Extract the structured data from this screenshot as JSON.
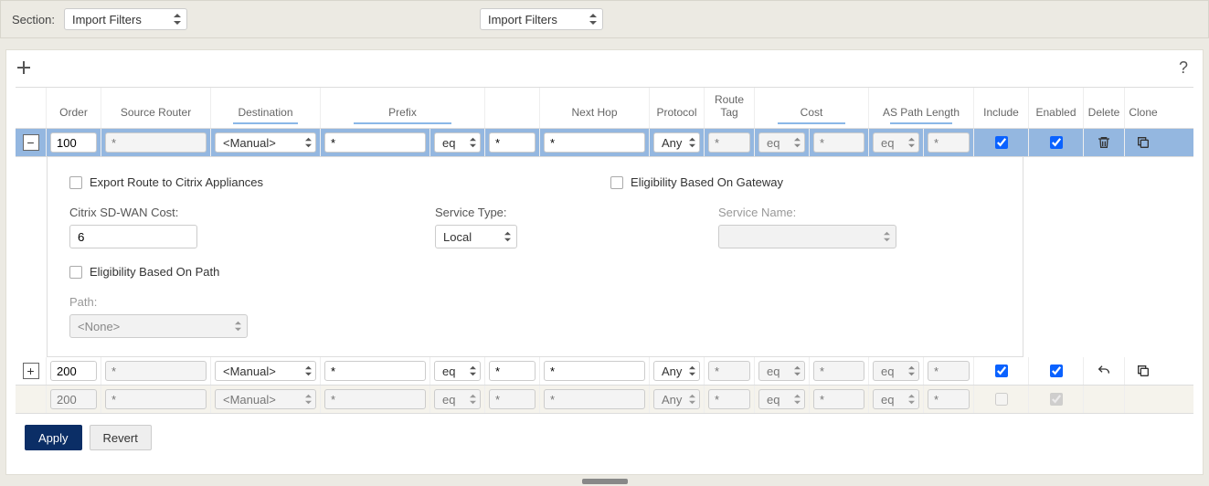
{
  "section": {
    "label": "Section:",
    "value_1": "Import Filters",
    "value_2": "Import Filters"
  },
  "toolbar": {
    "add_icon": "add-icon",
    "help_icon": "help-icon"
  },
  "columns": {
    "expand": "",
    "order": "Order",
    "source_router": "Source Router",
    "destination": "Destination",
    "prefix": "Prefix",
    "next_hop": "Next Hop",
    "protocol": "Protocol",
    "route_tag": "Route\nTag",
    "cost": "Cost",
    "as_path_length": "AS Path Length",
    "include": "Include",
    "enabled": "Enabled",
    "delete": "Delete",
    "clone": "Clone"
  },
  "rows": [
    {
      "expanded": true,
      "order": "100",
      "source_router": "*",
      "destination": "<Manual>",
      "prefix": "*",
      "prefix_op": "eq",
      "prefix_val": "*",
      "next_hop": "*",
      "protocol": "Any",
      "route_tag": "*",
      "cost_op": "eq",
      "cost_val": "*",
      "as_op": "eq",
      "as_val": "*",
      "include": true,
      "enabled": true,
      "delete_icon": "trash-icon",
      "clone_icon": "clone-icon"
    },
    {
      "expanded": false,
      "order": "200",
      "source_router": "*",
      "destination": "<Manual>",
      "prefix": "*",
      "prefix_op": "eq",
      "prefix_val": "*",
      "next_hop": "*",
      "protocol": "Any",
      "route_tag": "*",
      "cost_op": "eq",
      "cost_val": "*",
      "as_op": "eq",
      "as_val": "*",
      "include": true,
      "enabled": true,
      "delete_icon": "undo-icon",
      "clone_icon": "clone-icon"
    },
    {
      "readonly": true,
      "order": "200",
      "source_router": "*",
      "destination": "<Manual>",
      "prefix": "*",
      "prefix_op": "eq",
      "prefix_val": "*",
      "next_hop": "*",
      "protocol": "Any",
      "route_tag": "*",
      "cost_op": "eq",
      "cost_val": "*",
      "as_op": "eq",
      "as_val": "*",
      "include": false,
      "enabled": true
    }
  ],
  "detail": {
    "export_label": "Export Route to Citrix Appliances",
    "gateway_label": "Eligibility Based On Gateway",
    "sdwan_cost_label": "Citrix SD-WAN Cost:",
    "sdwan_cost_value": "6",
    "service_type_label": "Service Type:",
    "service_type_value": "Local",
    "service_name_label": "Service Name:",
    "service_name_value": "",
    "path_elig_label": "Eligibility Based On Path",
    "path_label": "Path:",
    "path_value": "<None>"
  },
  "footer": {
    "apply": "Apply",
    "revert": "Revert"
  }
}
